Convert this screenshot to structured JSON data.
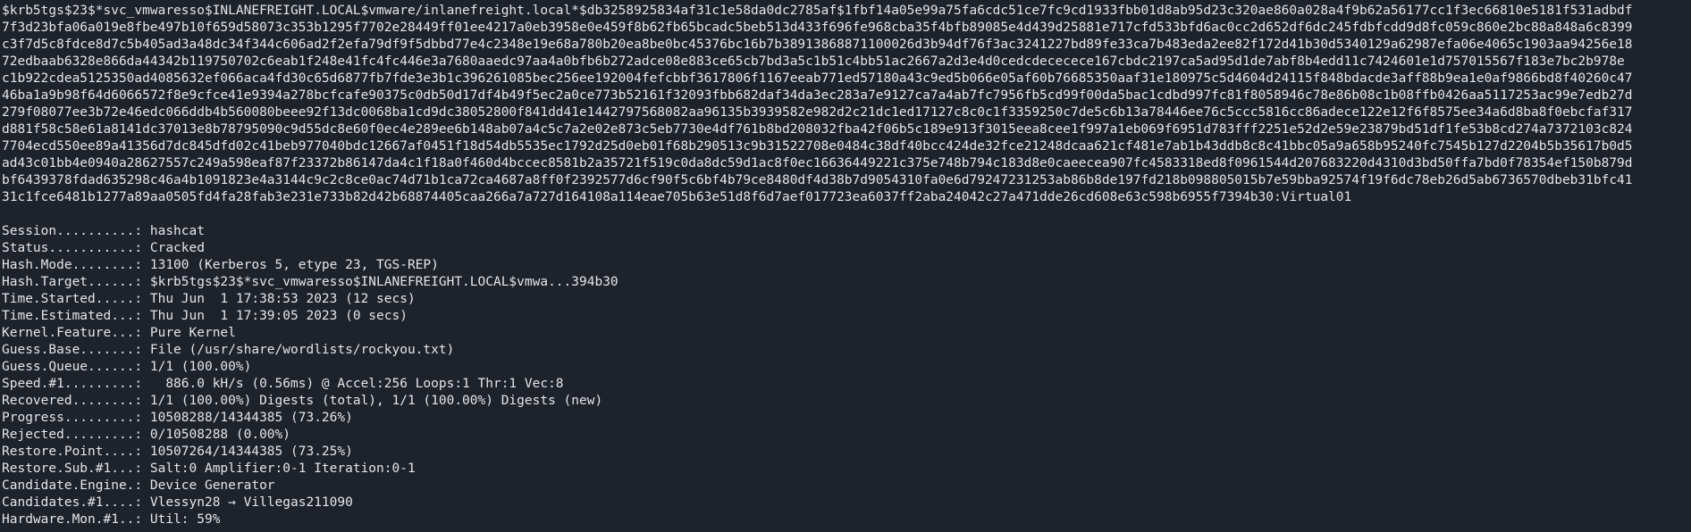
{
  "terminal": {
    "hash_lines": [
      "$krb5tgs$23$*svc_vmwaresso$INLANEFREIGHT.LOCAL$vmware/inlanefreight.local*$db3258925834af31c1e58da0dc2785af$1fbf14a05e99a75fa6cdc51ce7fc9cd1933fbb01d8ab95d23c320ae860a028a4f9b62a56177cc1f3ec66810e5181f531adbdf",
      "7f3d23bfa06a019e8fbe497b10f659d58073c353b1295f7702e28449ff01ee4217a0eb3958e0e459f8b62fb65bcadc5beb513d433f696fe968cba35f4bfb89085e4d439d25881e717cfd533bfd6ac0cc2d652df6dc245fdbfcdd9d8fc059c860e2bc88a848a6c8399",
      "c3f7d5c8fdce8d7c5b405ad3a48dc34f344c606ad2f2efa79df9f5dbbd77e4c2348e19e68a780b20ea8be0bc45376bc16b7b38913868871100026d3b94df76f3ac3241227bd89fe33ca7b483eda2ee82f172d41b30d5340129a62987efa06e4065c1903aa94256e18",
      "72edbaab6328e866da44342b119750702c6eab1f248e41fc4fc446e3a7680aaedc97aa4a0bfb6b272adce08e883ce65cb7bd3a5c1b51c4bb51ac2667a2d3e4d0cedcdececece167cbdc2197ca5ad95d1de7abf8b4edd11c7424601e1d757015567f183e7bc2b978e",
      "c1b922cdea5125350ad4085632ef066aca4fd30c65d6877fb7fde3e3b1c396261085bec256ee192004fefcbbf3617806f1167eeab771ed57180a43c9ed5b066e05af60b76685350aaf31e180975c5d4604d24115f848bdacde3aff88b9ea1e0af9866bd8f40260c47",
      "46ba1a9b98f64d6066572f8e9cfce41e9394a278bcfcafe90375c0db50d17df4b49f5ec2a0ce773b52161f32093fbb682daf34da3ec283a7e9127ca7a4ab7fc7956fb5cd99f00da5bac1cdbd997fc81f8058946c78e86b08c1b08ffb0426aa5117253ac99e7edb27d",
      "279f08077ee3b72e46edc066ddb4b560080beee92f13dc0068ba1cd9dc38052800f841dd41e1442797568082aa96135b3939582e982d2c21dc1ed17127c8c0c1f3359250c7de5c6b13a78446ee76c5ccc5816cc86adece122e12f6f8575ee34a6d8ba8f0ebcfaf317",
      "d881f58c58e61a8141dc37013e8b78795090c9d55dc8e60f0ec4e289ee6b148ab07a4c5c7a2e02e873c5eb7730e4df761b8bd208032fba42f06b5c189e913f3015eea8cee1f997a1eb069f6951d783fff2251e52d2e59e23879bd51df1fe53b8cd274a7372103c824",
      "7704ecd550ee89a41356d7dc845dfd02c41beb977040bdc12667af0451f18d54db5535ec1792d25d0eb01f68b290513c9b31522708e0484c38df40bcc424de32fce21248dcaa621cf481e7ab1b43ddb8c8c41bbc05a9a658b95240fc7545b127d2204b5b35617b0d5",
      "ad43c01bb4e0940a28627557c249a598eaf87f23372b86147da4c1f18a0f460d4bccec8581b2a35721f519c0da8dc59d1ac8f0ec16636449221c375e748b794c183d8e0caeecea907fc4583318ed8f0961544d207683220d4310d3bd50ffa7bd0f78354ef150b879d",
      "bf6439378fdad635298c46a4b1091823e4a3144c9c2c8ce0ac74d71b1ca72ca4687a8ff0f2392577d6cf90f5c6bf4b79ce8480df4d38b7d9054310fa0e6d79247231253ab86b8de197fd218b098805015b7e59bba92574f19f6dc78eb26d5ab6736570dbeb31bfc41",
      "31c1fce6481b1277a89aa0505fd4fa28fab3e231e733b82d42b68874405caa266a7a727d164108a114eae705b63e51d8f6d7aef017723ea6037ff2aba24042c27a471dde26cd608e63c598b6955f7394b30:Virtual01"
    ],
    "status_lines": [
      "Session..........: hashcat",
      "Status...........: Cracked",
      "Hash.Mode........: 13100 (Kerberos 5, etype 23, TGS-REP)",
      "Hash.Target......: $krb5tgs$23$*svc_vmwaresso$INLANEFREIGHT.LOCAL$vmwa...394b30",
      "Time.Started.....: Thu Jun  1 17:38:53 2023 (12 secs)",
      "Time.Estimated...: Thu Jun  1 17:39:05 2023 (0 secs)",
      "Kernel.Feature...: Pure Kernel",
      "Guess.Base.......: File (/usr/share/wordlists/rockyou.txt)",
      "Guess.Queue......: 1/1 (100.00%)",
      "Speed.#1.........:   886.0 kH/s (0.56ms) @ Accel:256 Loops:1 Thr:1 Vec:8",
      "Recovered........: 1/1 (100.00%) Digests (total), 1/1 (100.00%) Digests (new)",
      "Progress.........: 10508288/14344385 (73.26%)",
      "Rejected.........: 0/10508288 (0.00%)",
      "Restore.Point....: 10507264/14344385 (73.25%)",
      "Restore.Sub.#1...: Salt:0 Amplifier:0-1 Iteration:0-1",
      "Candidate.Engine.: Device Generator",
      "Candidates.#1....: Vlessyn28 → Villegas211090",
      "Hardware.Mon.#1..: Util: 59%"
    ]
  }
}
